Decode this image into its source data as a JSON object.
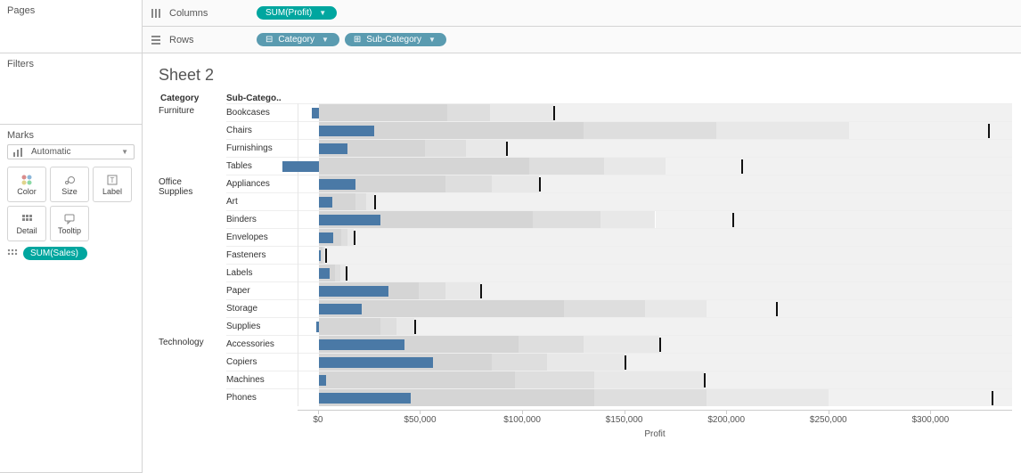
{
  "sidebar": {
    "pages_title": "Pages",
    "filters_title": "Filters",
    "marks_title": "Marks",
    "marks_dropdown": "Automatic",
    "mark_buttons": {
      "color": "Color",
      "size": "Size",
      "label": "Label",
      "detail": "Detail",
      "tooltip": "Tooltip"
    },
    "detail_pill": "SUM(Sales)"
  },
  "shelves": {
    "columns_label": "Columns",
    "rows_label": "Rows",
    "columns_pill": "SUM(Profit)",
    "rows_pill_1": "Category",
    "rows_pill_2": "Sub-Category"
  },
  "sheet_title": "Sheet 2",
  "header_category": "Category",
  "header_subcategory": "Sub-Catego..",
  "axis": {
    "title": "Profit",
    "ticks": [
      "$0",
      "$50,000",
      "$100,000",
      "$150,000",
      "$200,000",
      "$250,000",
      "$300,000"
    ]
  },
  "chart_data": {
    "type": "bar",
    "xlabel": "Profit",
    "xlim": [
      -10000,
      340000
    ],
    "axis_tick_positions": [
      0,
      50000,
      100000,
      150000,
      200000,
      250000,
      300000
    ],
    "categories": [
      {
        "name": "Furniture",
        "subs": [
          {
            "name": "Bookcases",
            "profit": -3500,
            "tick": 115000,
            "bands": [
              63000,
              84000,
              115000,
              340000
            ]
          },
          {
            "name": "Chairs",
            "profit": 27000,
            "tick": 328000,
            "bands": [
              130000,
              195000,
              260000,
              340000
            ]
          },
          {
            "name": "Furnishings",
            "profit": 14000,
            "tick": 92000,
            "bands": [
              52000,
              72000,
              92000,
              340000
            ]
          },
          {
            "name": "Tables",
            "profit": -18000,
            "tick": 207000,
            "bands": [
              103000,
              140000,
              170000,
              340000
            ]
          }
        ]
      },
      {
        "name": "Office\nSupplies",
        "subs": [
          {
            "name": "Appliances",
            "profit": 18000,
            "tick": 108000,
            "bands": [
              62000,
              85000,
              108000,
              340000
            ]
          },
          {
            "name": "Art",
            "profit": 6500,
            "tick": 27000,
            "bands": [
              18000,
              23000,
              27000,
              340000
            ]
          },
          {
            "name": "Binders",
            "profit": 30000,
            "tick": 203000,
            "bands": [
              105000,
              138000,
              165000,
              340000
            ]
          },
          {
            "name": "Envelopes",
            "profit": 7000,
            "tick": 17000,
            "bands": [
              11000,
              14000,
              17000,
              340000
            ]
          },
          {
            "name": "Fasteners",
            "profit": 1000,
            "tick": 3000,
            "bands": [
              2000,
              2500,
              3000,
              340000
            ]
          },
          {
            "name": "Labels",
            "profit": 5500,
            "tick": 13000,
            "bands": [
              8000,
              10500,
              13000,
              340000
            ]
          },
          {
            "name": "Paper",
            "profit": 34000,
            "tick": 79000,
            "bands": [
              49000,
              62000,
              79000,
              340000
            ]
          },
          {
            "name": "Storage",
            "profit": 21000,
            "tick": 224000,
            "bands": [
              120000,
              160000,
              190000,
              340000
            ]
          },
          {
            "name": "Supplies",
            "profit": -1200,
            "tick": 47000,
            "bands": [
              30000,
              38000,
              47000,
              340000
            ]
          }
        ]
      },
      {
        "name": "Technology",
        "subs": [
          {
            "name": "Accessories",
            "profit": 42000,
            "tick": 167000,
            "bands": [
              98000,
              130000,
              167000,
              340000
            ]
          },
          {
            "name": "Copiers",
            "profit": 56000,
            "tick": 150000,
            "bands": [
              85000,
              112000,
              150000,
              340000
            ]
          },
          {
            "name": "Machines",
            "profit": 3400,
            "tick": 189000,
            "bands": [
              96000,
              135000,
              189000,
              340000
            ]
          },
          {
            "name": "Phones",
            "profit": 45000,
            "tick": 330000,
            "bands": [
              135000,
              190000,
              250000,
              340000
            ]
          }
        ]
      }
    ]
  }
}
